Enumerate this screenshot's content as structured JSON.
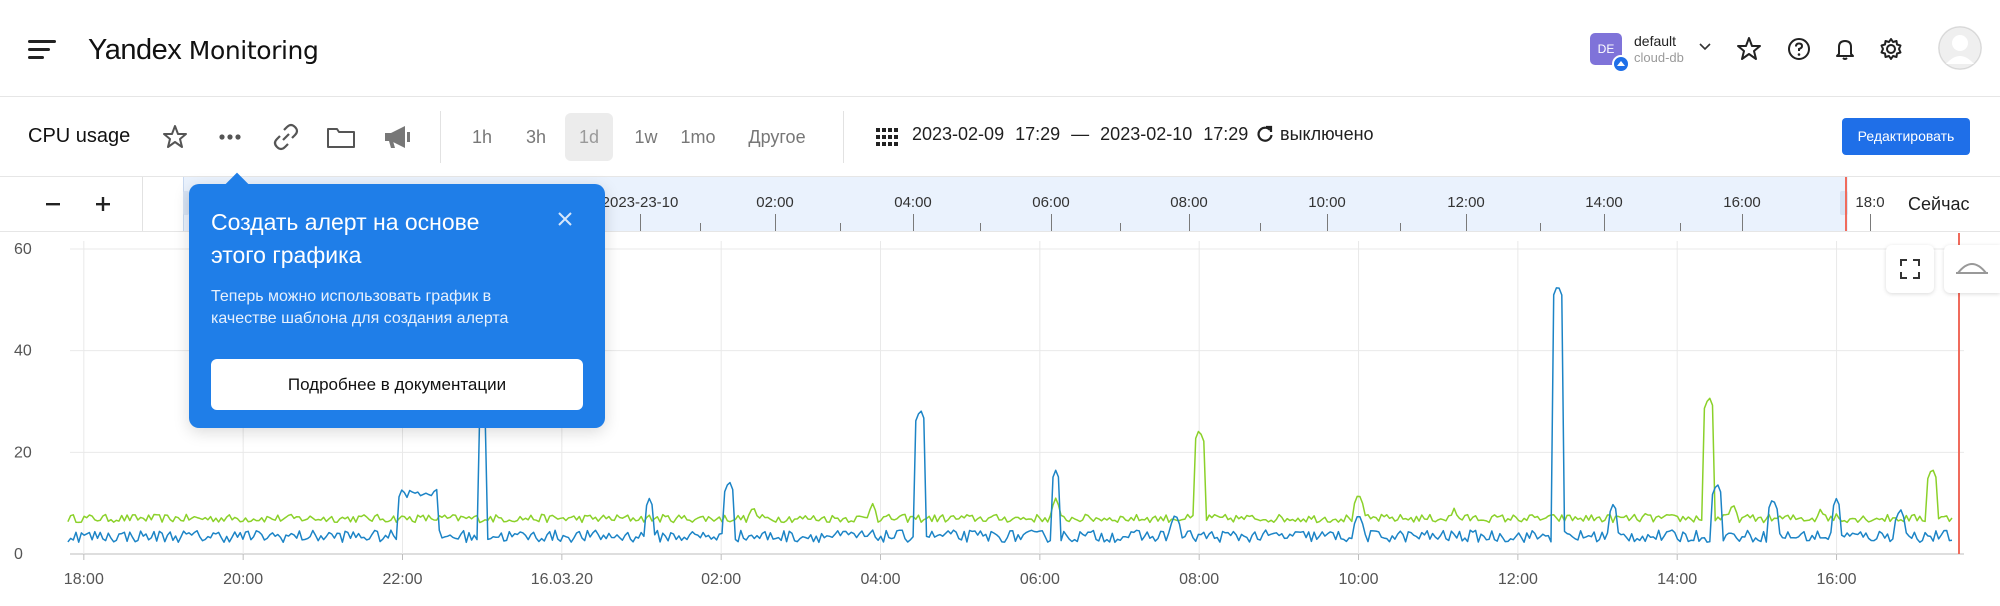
{
  "header": {
    "logo_brand": "Yandex",
    "logo_product": "Monitoring",
    "account": {
      "badge": "DE",
      "name": "default",
      "cloud": "cloud-db"
    }
  },
  "toolbar": {
    "title": "CPU usage",
    "ranges": [
      "1h",
      "3h",
      "1d",
      "1w",
      "1mo",
      "Другое"
    ],
    "active_range": "1d",
    "date_from": "2023-02-09",
    "time_from": "17:29",
    "dash": "—",
    "date_to": "2023-02-10",
    "time_to": "17:29",
    "refresh_label": "выключено",
    "edit_label": "Редактировать"
  },
  "timeline": {
    "labels": [
      "2023-23-10",
      "02:00",
      "04:00",
      "06:00",
      "08:00",
      "10:00",
      "12:00",
      "14:00",
      "16:00",
      "18:0"
    ],
    "now_label": "Сейчас"
  },
  "popup": {
    "title": "Создать алерт на основе этого графика",
    "text": "Теперь можно использовать график в качестве шаблона для создания алерта",
    "button": "Подробнее в документации"
  },
  "colors": {
    "accent": "#1f6fe8",
    "popup_bg": "#1f7ee8",
    "series_blue": "#1c84c6",
    "series_green": "#8bd12a",
    "now_line": "#f06b5c"
  },
  "chart_data": {
    "type": "line",
    "x_tick_labels": [
      "18:00",
      "20:00",
      "22:00",
      "16.03.20",
      "02:00",
      "04:00",
      "06:00",
      "08:00",
      "10:00",
      "12:00",
      "14:00",
      "16:00"
    ],
    "y_tick_labels": [
      "0",
      "20",
      "40",
      "60"
    ],
    "ylim": [
      0,
      60
    ],
    "xlim_hours": [
      -0.5,
      23.6
    ],
    "grid": true,
    "series": [
      {
        "color": "#8bd12a",
        "baseline": 7,
        "noise": 0.8,
        "spikes": [
          [
            8.4,
            9.5
          ],
          [
            9.9,
            10
          ],
          [
            10.4,
            7
          ],
          [
            12.2,
            11
          ],
          [
            14.0,
            24.5
          ],
          [
            16.0,
            12
          ],
          [
            17.2,
            9
          ],
          [
            19.6,
            8
          ],
          [
            20.4,
            31
          ],
          [
            20.7,
            10
          ],
          [
            21.8,
            9
          ],
          [
            22.0,
            8
          ],
          [
            23.2,
            17
          ]
        ]
      },
      {
        "color": "#1c84c6",
        "baseline": 3.5,
        "noise": 1.2,
        "spikes": [
          [
            -0.4,
            7.5
          ],
          [
            4.0,
            13
          ],
          [
            4.2,
            12.5
          ],
          [
            4.4,
            12.5
          ],
          [
            5.0,
            29
          ],
          [
            7.1,
            11
          ],
          [
            8.1,
            14.5
          ],
          [
            10.5,
            28.5
          ],
          [
            12.2,
            16.5
          ],
          [
            13.7,
            8
          ],
          [
            16.0,
            8
          ],
          [
            18.5,
            53
          ],
          [
            19.2,
            10
          ],
          [
            20.5,
            14
          ],
          [
            21.2,
            11
          ],
          [
            22.0,
            11
          ],
          [
            22.8,
            9
          ],
          [
            23.6,
            6
          ]
        ]
      }
    ]
  }
}
